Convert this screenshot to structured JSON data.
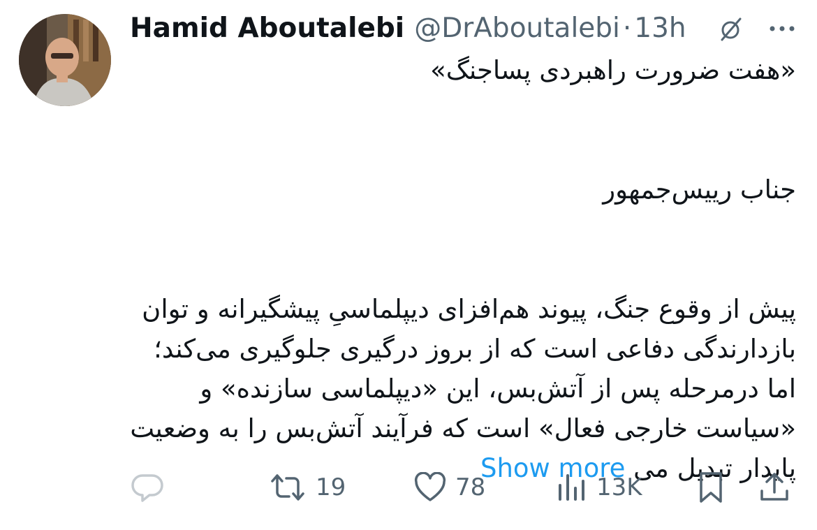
{
  "author": {
    "display_name": "Hamid Aboutalebi",
    "handle": "@DrAboutalebi",
    "separator": "·",
    "time": "13h"
  },
  "header": {
    "grok_icon": "slashed-circle-icon",
    "more_icon": "more-dots-icon"
  },
  "tweet": {
    "lines": [
      "«هفت ضرورت راهبردی پساجنگ»",
      "",
      "جناب رییس‌جمهور",
      "",
      "پیش از وقوع جنگ، پیوند هم‌افزای دیپلماسیِ پیشگیرانه و توان بازدارندگی دفاعی است که از بروز درگیری جلوگیری می‌کند؛ اما درمرحله پس از آتش‌بس، این «دیپلماسی سازنده» و «سیاست خارجی فعال» است که فرآیند آتش‌بس را به وضعیت پایدار تبدیل می"
    ],
    "show_more": "Show more"
  },
  "actions": {
    "reply": {
      "icon": "reply-icon",
      "count": ""
    },
    "repost": {
      "icon": "repost-icon",
      "count": "19"
    },
    "like": {
      "icon": "heart-icon",
      "count": "78"
    },
    "views": {
      "icon": "views-icon",
      "count": "13K"
    },
    "bookmark": {
      "icon": "bookmark-icon"
    },
    "share": {
      "icon": "share-icon"
    }
  },
  "colors": {
    "text": "#0f1419",
    "secondary": "#536471",
    "link": "#1d9bf0"
  }
}
